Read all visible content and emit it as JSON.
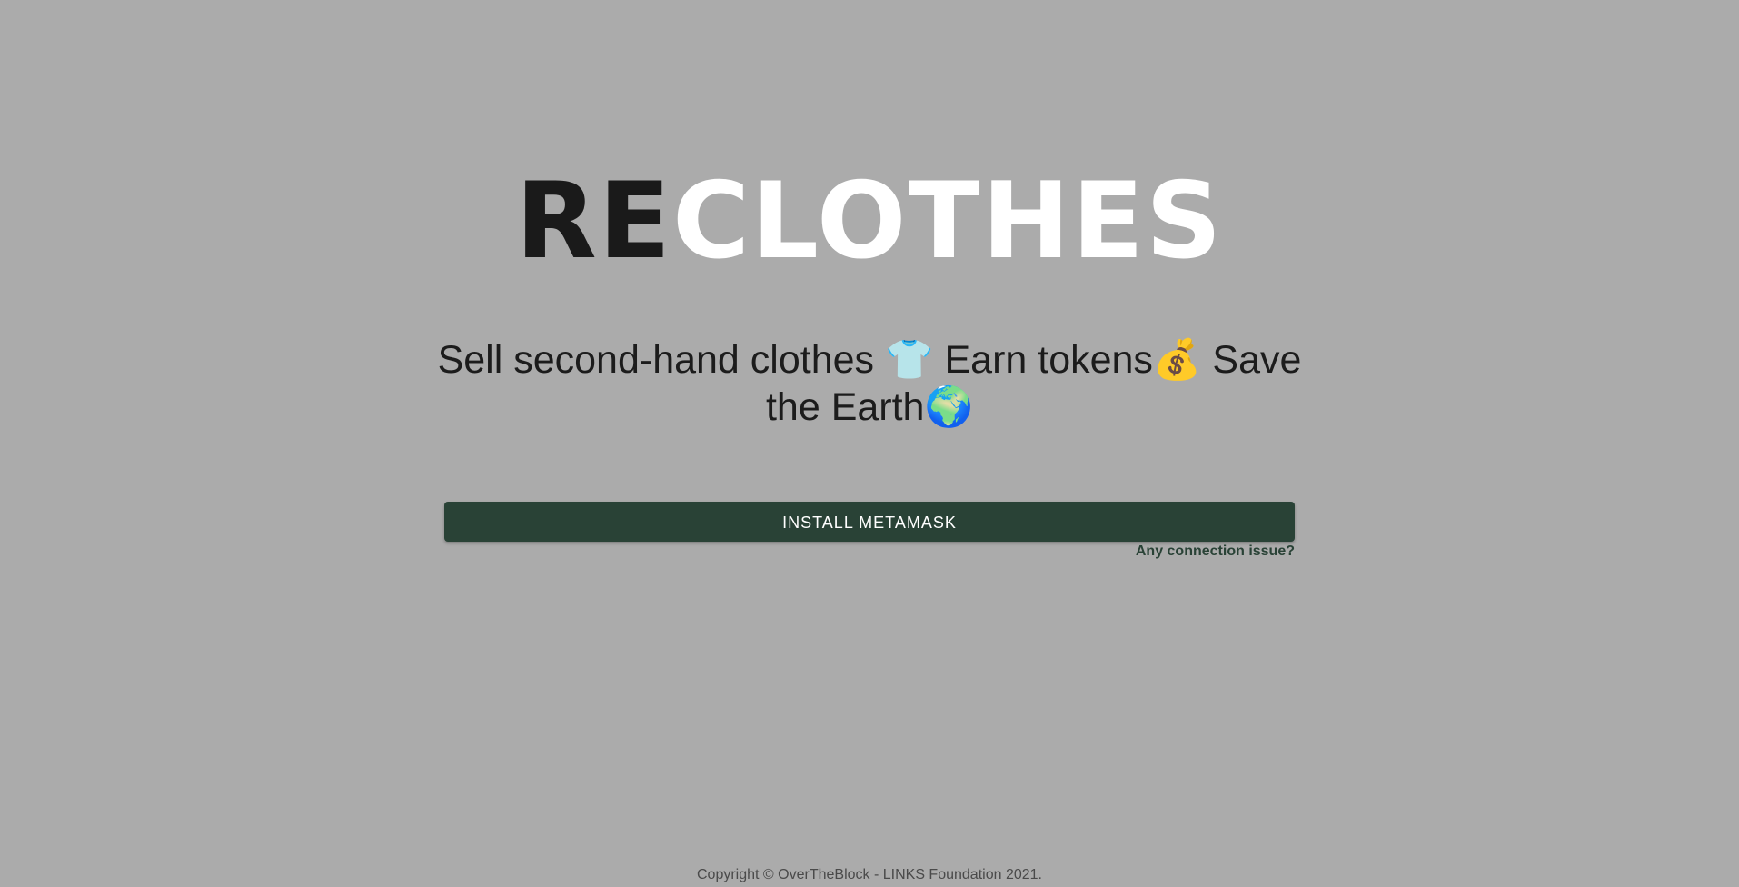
{
  "logo": {
    "part_dark": "RE",
    "part_light": "CLOTHES"
  },
  "tagline": {
    "text": "Sell second-hand clothes 👕 Earn tokens💰 Save the Earth🌍"
  },
  "install_button": {
    "label": "INSTALL METAMASK"
  },
  "connection_link": {
    "label": "Any connection issue?"
  },
  "footer": {
    "copyright": "Copyright © OverTheBlock - LINKS Foundation 2021."
  },
  "colors": {
    "background": "#ababab",
    "button": "#294236",
    "logo_dark": "#1a1a1a",
    "logo_light": "#ffffff"
  }
}
